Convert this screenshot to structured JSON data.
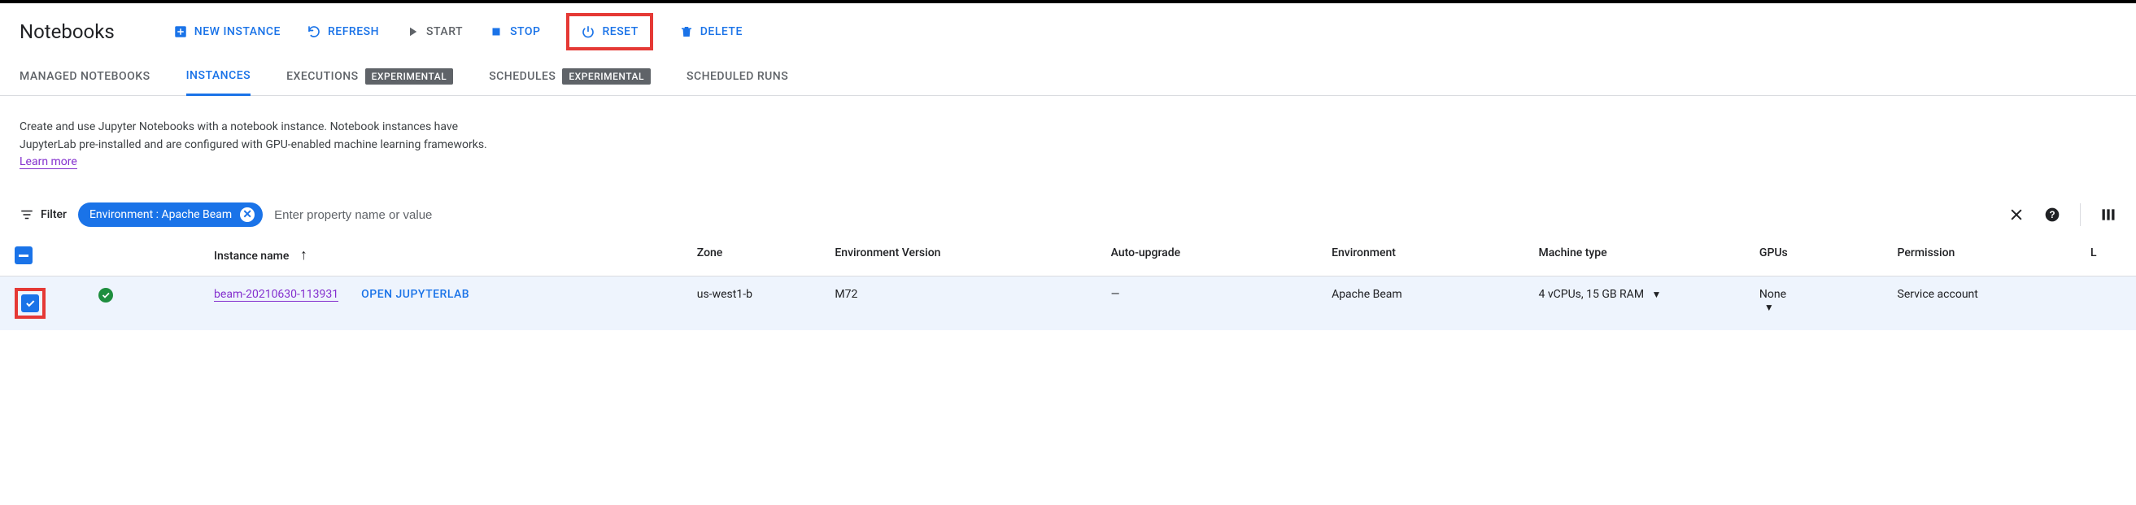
{
  "page_title": "Notebooks",
  "actions": {
    "new_instance": "NEW INSTANCE",
    "refresh": "REFRESH",
    "start": "START",
    "stop": "STOP",
    "reset": "RESET",
    "delete": "DELETE"
  },
  "tabs": {
    "managed": "MANAGED NOTEBOOKS",
    "instances": "INSTANCES",
    "executions": "EXECUTIONS",
    "executions_badge": "EXPERIMENTAL",
    "schedules": "SCHEDULES",
    "schedules_badge": "EXPERIMENTAL",
    "scheduled_runs": "SCHEDULED RUNS"
  },
  "intro": "Create and use Jupyter Notebooks with a notebook instance. Notebook instances have JupyterLab pre-installed and are configured with GPU-enabled machine learning frameworks.",
  "learn_more": "Learn more",
  "filter": {
    "label": "Filter",
    "chip": "Environment : Apache Beam",
    "placeholder": "Enter property name or value"
  },
  "columns": {
    "instance_name": "Instance name",
    "zone": "Zone",
    "env_version": "Environment Version",
    "auto_upgrade": "Auto-upgrade",
    "environment": "Environment",
    "machine_type": "Machine type",
    "gpus": "GPUs",
    "permission": "Permission",
    "last": "L"
  },
  "rows": [
    {
      "name": "beam-20210630-113931",
      "open_label": "OPEN JUPYTERLAB",
      "zone": "us-west1-b",
      "env_version": "M72",
      "auto_upgrade": "—",
      "environment": "Apache Beam",
      "machine_type": "4 vCPUs, 15 GB RAM",
      "gpus": "None",
      "permission": "Service account"
    }
  ]
}
